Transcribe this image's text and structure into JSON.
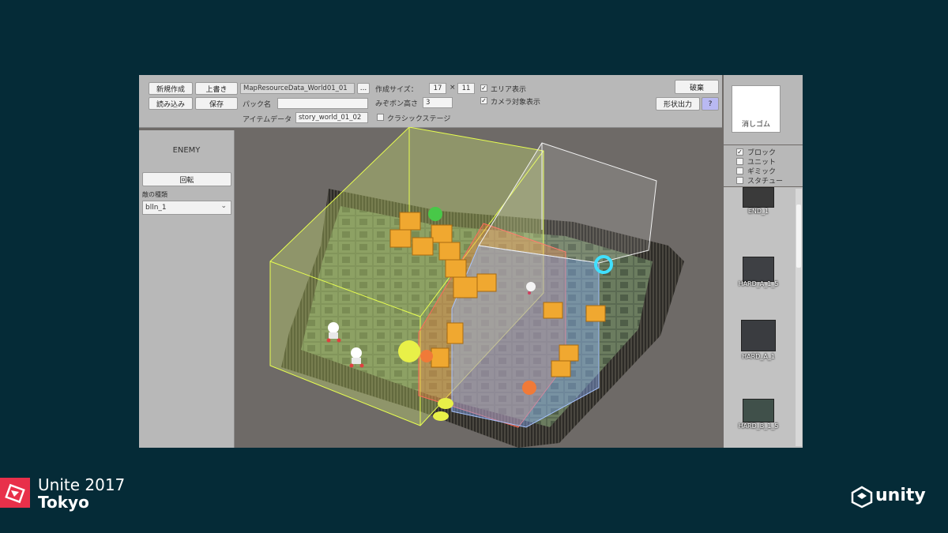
{
  "toolbar": {
    "new_label": "新規作成",
    "overwrite_label": "上書き",
    "load_label": "読み込み",
    "save_label": "保存",
    "resource_value": "MapResourceData_World01_01",
    "browse_label": "...",
    "size_label": "作成サイズ：",
    "size_x": "17",
    "size_sep": "×",
    "size_y": "11",
    "area_display_label": "エリア表示",
    "camera_display_label": "カメラ対象表示",
    "pack_name_label": "パック名",
    "pack_name_value": "",
    "bottom_height_label": "みぞボン高さ",
    "bottom_height_value": "3",
    "item_data_label": "アイテムデータ",
    "item_data_value": "story_world_01_02",
    "classic_stage_label": "クラシックステージ",
    "destroy_label": "破棄",
    "shape_output_label": "形状出力",
    "help_label": "?"
  },
  "left_panel": {
    "title": "ENEMY",
    "rotate_label": "回転",
    "enemy_type_label": "敵の種類",
    "enemy_type_value": "blln_1"
  },
  "eraser": {
    "label": "消しゴム"
  },
  "filters": [
    {
      "label": "ブロック",
      "checked": true
    },
    {
      "label": "ユニット",
      "checked": false
    },
    {
      "label": "ギミック",
      "checked": false
    },
    {
      "label": "スタチュー",
      "checked": false
    }
  ],
  "parts": [
    "END_1",
    "HARD_A_1_5",
    "HARD_A_1",
    "HARD_B_1_5"
  ],
  "branding": {
    "event": "Unite 2017",
    "city": "Tokyo",
    "brand": "unity"
  },
  "colors": {
    "background": "#052b37",
    "accent": "#e8304a"
  }
}
